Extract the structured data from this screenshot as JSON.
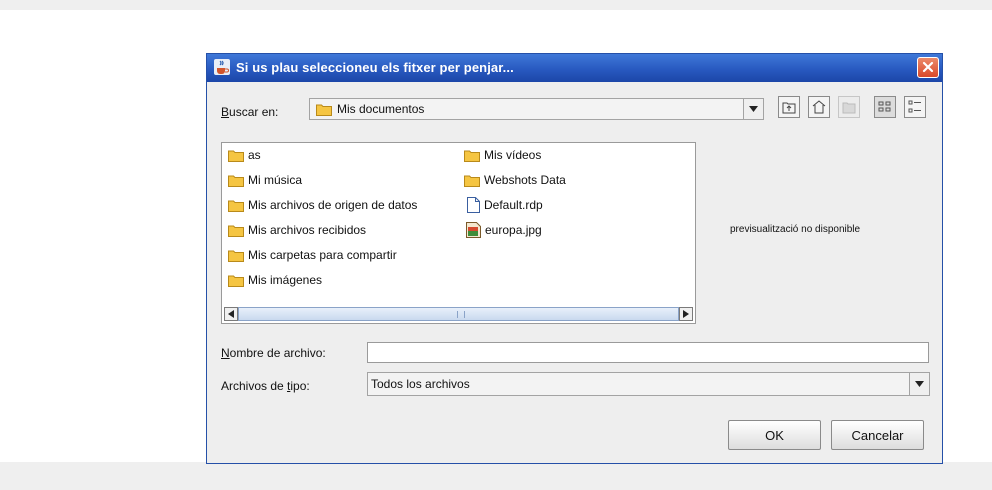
{
  "dialog": {
    "title": "Si us plau seleccioneu els fitxer per penjar...",
    "app_icon": "java-cup-icon",
    "close_icon": "close-icon"
  },
  "lookin": {
    "label_u": "B",
    "label_rest": "uscar en:",
    "value": "Mis documentos",
    "icon": "folder-icon"
  },
  "toolbar": {
    "buttons": [
      {
        "name": "up-one-level-icon",
        "enabled": true
      },
      {
        "name": "home-icon",
        "enabled": true
      },
      {
        "name": "new-folder-icon",
        "enabled": false
      },
      {
        "name": "list-view-icon",
        "enabled": true,
        "selected": true
      },
      {
        "name": "details-view-icon",
        "enabled": true
      }
    ]
  },
  "files": {
    "col1": [
      {
        "name": "as",
        "type": "folder"
      },
      {
        "name": "Mi música",
        "type": "folder"
      },
      {
        "name": "Mis archivos de origen de datos",
        "type": "folder"
      },
      {
        "name": "Mis archivos recibidos",
        "type": "folder"
      },
      {
        "name": "Mis carpetas para compartir",
        "type": "folder"
      },
      {
        "name": "Mis imágenes",
        "type": "folder"
      }
    ],
    "col2": [
      {
        "name": "Mis vídeos",
        "type": "folder"
      },
      {
        "name": "Webshots Data",
        "type": "folder"
      },
      {
        "name": "Default.rdp",
        "type": "file"
      },
      {
        "name": "europa.jpg",
        "type": "image"
      }
    ]
  },
  "preview_text": "previsualització no disponible",
  "filename": {
    "label_u": "N",
    "label_rest": "ombre de archivo:",
    "value": ""
  },
  "filetype": {
    "label_pre": "Archivos de ",
    "label_u": "t",
    "label_rest": "ipo:",
    "value": "Todos los archivos"
  },
  "buttons": {
    "ok": "OK",
    "cancel": "Cancelar"
  },
  "colors": {
    "titlebar": "#2859c0",
    "folder": "#f5c542"
  }
}
